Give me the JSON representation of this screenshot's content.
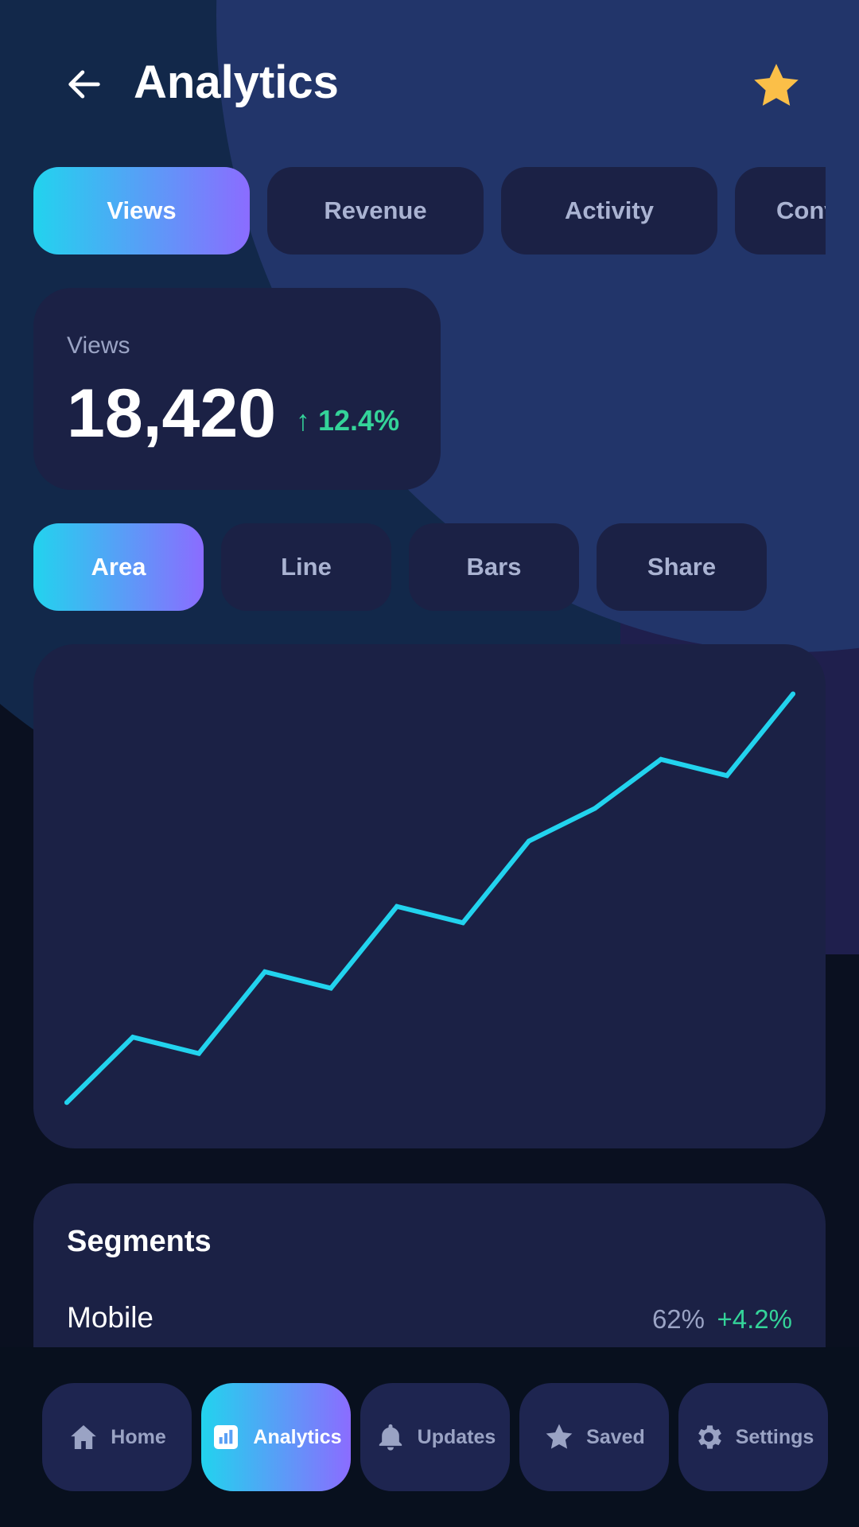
{
  "header": {
    "title": "Analytics",
    "back_icon": "arrow-left-icon",
    "favorite_icon": "star-icon",
    "favorite_color": "#fbbf48"
  },
  "tabs": [
    {
      "label": "Views",
      "active": true
    },
    {
      "label": "Revenue",
      "active": false
    },
    {
      "label": "Activity",
      "active": false
    },
    {
      "label": "Conversions",
      "active": false
    }
  ],
  "kpi": {
    "label": "Views",
    "value": "18,420",
    "delta": "↑ 12.4%",
    "delta_color": "#34d399"
  },
  "chart_types": [
    {
      "label": "Area",
      "active": true
    },
    {
      "label": "Line",
      "active": false
    },
    {
      "label": "Bars",
      "active": false
    },
    {
      "label": "Share",
      "active": false
    }
  ],
  "chart_data": {
    "type": "line",
    "title": "",
    "xlabel": "",
    "ylabel": "",
    "grid": false,
    "series": [
      {
        "color": "#22d3ee",
        "values": [
          10,
          22,
          19,
          34,
          31,
          46,
          43,
          58,
          64,
          73,
          70,
          85
        ]
      }
    ],
    "ylim": [
      8,
      88
    ]
  },
  "segments": {
    "title": "Segments",
    "rows": [
      {
        "name": "Mobile",
        "pct": "62%",
        "delta": "+4.2%"
      }
    ]
  },
  "bottom_nav": [
    {
      "label": "Home",
      "icon": "home-icon",
      "active": false
    },
    {
      "label": "Analytics",
      "icon": "analytics-icon",
      "active": true
    },
    {
      "label": "Updates",
      "icon": "bell-icon",
      "active": false
    },
    {
      "label": "Saved",
      "icon": "star-icon",
      "active": false
    },
    {
      "label": "Settings",
      "icon": "gear-icon",
      "active": false
    }
  ],
  "colors": {
    "accent_start": "#22d3ee",
    "accent_end": "#8b6cff",
    "card": "#1b2145",
    "positive": "#34d399"
  }
}
